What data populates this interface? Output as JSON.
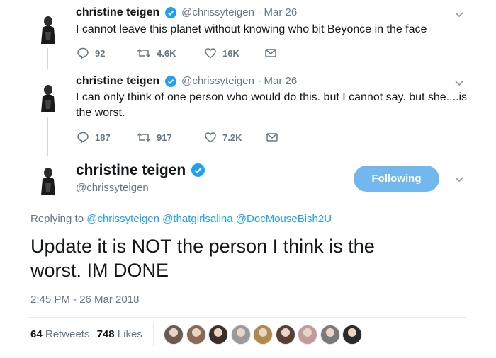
{
  "colors": {
    "link": "#1da1f2",
    "text": "#14171a",
    "muted": "#657786",
    "follow_button": "#72b7ee",
    "verified": "#1da1f2"
  },
  "tweets": [
    {
      "name": "christine teigen",
      "handle": "@chrissyteigen",
      "date": "· Mar 26",
      "text": "I cannot leave this planet without knowing who bit Beyonce in the face",
      "replies": "92",
      "retweets": "4.6K",
      "likes": "16K"
    },
    {
      "name": "christine teigen",
      "handle": "@chrissyteigen",
      "date": "· Mar 26",
      "text_line1": "I can only think of one person who would do this. but I cannot say. but she....is",
      "text_line2": "the worst.",
      "replies": "187",
      "retweets": "917",
      "likes": "7.2K"
    }
  ],
  "main_tweet": {
    "name": "christine teigen",
    "handle": "@chrissyteigen",
    "follow_label": "Following",
    "replying_prefix": "Replying to",
    "replying_to": [
      "@chrissyteigen",
      "@thatgirlsalina",
      "@DocMouseBish2U"
    ],
    "text_line1": "Update it is NOT the person I think is the",
    "text_line2": "worst. IM DONE",
    "timestamp": "2:45 PM - 26 Mar 2018",
    "retweets_count": "64",
    "retweets_label": "Retweets",
    "likes_count": "748",
    "likes_label": "Likes",
    "liker_avatar_colors": [
      "#6b5a4e",
      "#8a6a55",
      "#3c2f2a",
      "#9a9a9a",
      "#b08a4a",
      "#5a3e36",
      "#c49a9a",
      "#7a7a7a",
      "#2a2a2a"
    ]
  }
}
